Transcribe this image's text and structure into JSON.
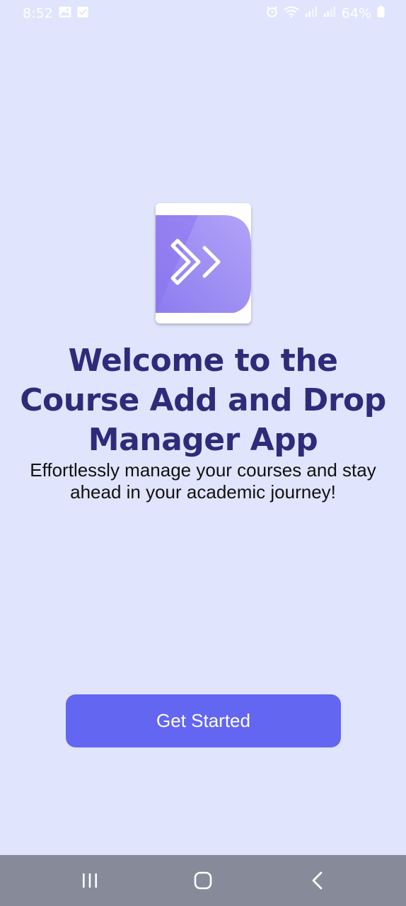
{
  "status_bar": {
    "time": "8:52",
    "battery_percent": "64%",
    "icons": [
      "image-icon",
      "check-icon",
      "alarm-icon",
      "wifi-icon",
      "signal-icon",
      "signal-icon",
      "battery-icon"
    ]
  },
  "logo": {
    "icon": "double-chevron-right-icon"
  },
  "welcome": {
    "title": "Welcome to the Course Add and Drop Manager App",
    "subtitle": "Effortlessly manage your courses and stay ahead in your academic journey!"
  },
  "actions": {
    "get_started_label": "Get Started"
  },
  "nav_bar": {
    "buttons": [
      "recent-apps-icon",
      "home-icon",
      "back-icon"
    ]
  },
  "colors": {
    "background": "#e0e5fd",
    "title": "#2f2b7a",
    "button": "#6366f1",
    "nav_bar": "#878a99",
    "logo_gradient_start": "#8b7cf0",
    "logo_gradient_end": "#b3a3f7"
  }
}
